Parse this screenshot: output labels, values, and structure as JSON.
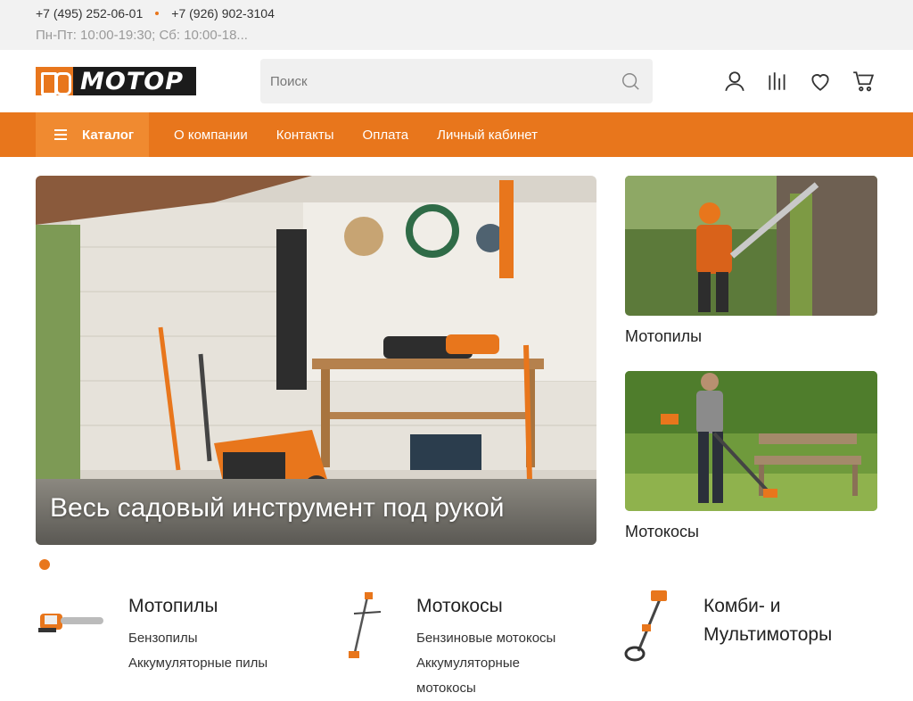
{
  "topbar": {
    "phone1": "+7 (495) 252-06-01",
    "phone2": "+7 (926) 902-3104",
    "hours": "Пн-Пт: 10:00-19:30; Сб: 10:00-18..."
  },
  "header": {
    "logo_text": "МОТОР",
    "search_placeholder": "Поиск",
    "icons": [
      "user-icon",
      "compare-icon",
      "heart-icon",
      "cart-icon"
    ]
  },
  "nav": {
    "catalog_label": "Каталог",
    "links": [
      "О компании",
      "Контакты",
      "Оплата",
      "Личный кабинет"
    ]
  },
  "hero": {
    "title": "Весь садовый инструмент под рукой"
  },
  "side_cards": [
    {
      "label": "Мотопилы"
    },
    {
      "label": "Мотокосы"
    }
  ],
  "categories": [
    {
      "title": "Мотопилы",
      "items": [
        "Бензопилы",
        "Аккумуляторные пилы"
      ]
    },
    {
      "title": "Мотокосы",
      "items": [
        "Бензиновые мотокосы",
        "Аккумуляторные мотокосы"
      ]
    },
    {
      "title_line1": "Комби- и",
      "title_line2": "Мультимоторы"
    }
  ],
  "colors": {
    "accent": "#e8761c",
    "topbar_bg": "#f2f2f2"
  }
}
